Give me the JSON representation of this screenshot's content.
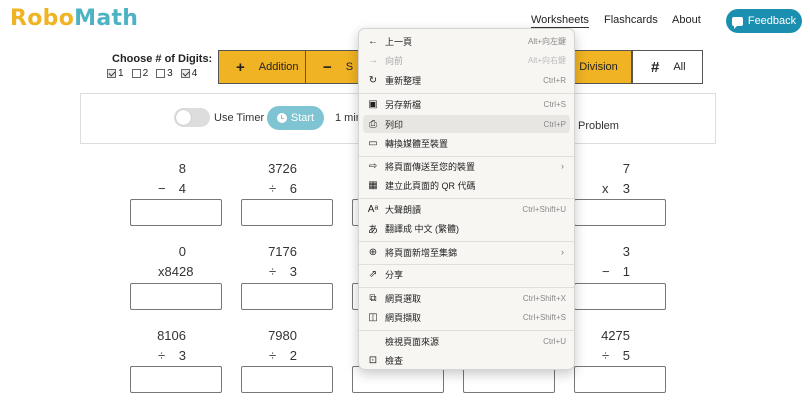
{
  "header": {
    "logo_robo": "Robo",
    "logo_math": "Math",
    "nav": [
      "Worksheets",
      "Flashcards",
      "About"
    ],
    "feedback_label": "Feedback"
  },
  "digits": {
    "title": "Choose # of Digits:",
    "options": [
      {
        "label": "1",
        "checked": true
      },
      {
        "label": "2",
        "checked": false
      },
      {
        "label": "3",
        "checked": false
      },
      {
        "label": "4",
        "checked": true
      }
    ]
  },
  "operations": {
    "addition": {
      "symbol": "+",
      "label": "Addition"
    },
    "subtraction": {
      "symbol": "−",
      "label": "S"
    },
    "division": {
      "label": "Division"
    },
    "all": {
      "symbol": "#",
      "label": "All"
    }
  },
  "timer": {
    "label": "Use Timer",
    "start_label": "Start",
    "minute_label": "1 min",
    "problem_label": "Problem"
  },
  "problems": [
    {
      "top": "8",
      "op": "−",
      "bottom": "4"
    },
    {
      "top": "3726",
      "op": "÷",
      "bottom": "6"
    },
    {
      "top": "7",
      "op": "x",
      "bottom": "3"
    },
    {
      "top": "0",
      "op": "x",
      "bottom": "8428"
    },
    {
      "top": "7176",
      "op": "÷",
      "bottom": "3"
    },
    {
      "top": "3",
      "op": "−",
      "bottom": "1"
    },
    {
      "top": "8106",
      "op": "÷",
      "bottom": "3"
    },
    {
      "top": "7980",
      "op": "÷",
      "bottom": "2"
    },
    {
      "top": "4275",
      "op": "÷",
      "bottom": "5"
    }
  ],
  "context_menu": {
    "items": [
      {
        "icon": "←",
        "label": "上一頁",
        "shortcut": "Alt+向左鍵",
        "disabled": false
      },
      {
        "icon": "→",
        "label": "向前",
        "shortcut": "Alt+向右鍵",
        "disabled": true
      },
      {
        "icon": "↻",
        "label": "重新整理",
        "shortcut": "Ctrl+R",
        "disabled": false
      },
      {
        "icon": "▣",
        "label": "另存新檔",
        "shortcut": "Ctrl+S",
        "disabled": false
      },
      {
        "icon": "⎙",
        "label": "列印",
        "shortcut": "Ctrl+P",
        "disabled": false
      },
      {
        "icon": "▭",
        "label": "轉換媒體至裝置",
        "shortcut": "",
        "disabled": false
      },
      {
        "icon": "⇨",
        "label": "將頁面傳送至您的裝置",
        "shortcut": "",
        "disabled": false
      },
      {
        "icon": "▦",
        "label": "建立此頁面的 QR 代碼",
        "shortcut": "",
        "disabled": false
      },
      {
        "icon": "Aᵃ",
        "label": "大聲朗讀",
        "shortcut": "Ctrl+Shift+U",
        "disabled": false
      },
      {
        "icon": "あ",
        "label": "翻譯成 中文 (繁體)",
        "shortcut": "",
        "disabled": false
      },
      {
        "icon": "⊕",
        "label": "將頁面新增至集錦",
        "shortcut": "",
        "disabled": false
      },
      {
        "icon": "⇗",
        "label": "分享",
        "shortcut": "",
        "disabled": false
      },
      {
        "icon": "⧉",
        "label": "網頁選取",
        "shortcut": "Ctrl+Shift+X",
        "disabled": false
      },
      {
        "icon": "◫",
        "label": "網頁擷取",
        "shortcut": "Ctrl+Shift+S",
        "disabled": false
      },
      {
        "icon": "",
        "label": "檢視頁面來源",
        "shortcut": "Ctrl+U",
        "disabled": false
      },
      {
        "icon": "⊡",
        "label": "檢查",
        "shortcut": "",
        "disabled": false
      }
    ]
  }
}
